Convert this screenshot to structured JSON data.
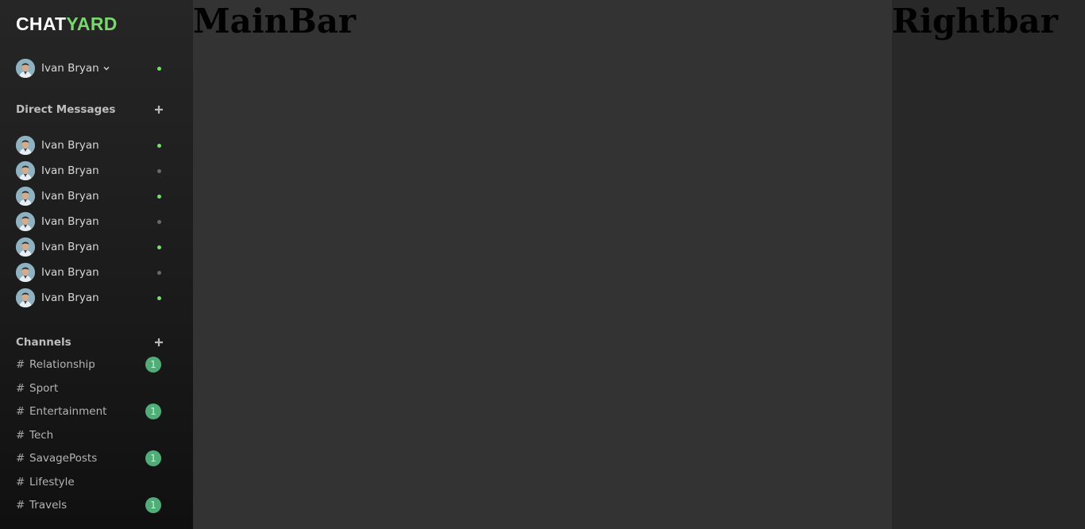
{
  "logo": {
    "part1": "CHAT",
    "part2": "YARD"
  },
  "current_user": {
    "name": "Ivan Bryan",
    "status": "online"
  },
  "direct_messages": {
    "title": "Direct Messages",
    "users": [
      {
        "name": "Ivan Bryan",
        "status": "online"
      },
      {
        "name": "Ivan Bryan",
        "status": "offline"
      },
      {
        "name": "Ivan Bryan",
        "status": "online"
      },
      {
        "name": "Ivan Bryan",
        "status": "offline"
      },
      {
        "name": "Ivan Bryan",
        "status": "online"
      },
      {
        "name": "Ivan Bryan",
        "status": "offline"
      },
      {
        "name": "Ivan Bryan",
        "status": "online"
      }
    ]
  },
  "channels": {
    "title": "Channels",
    "prefix": "#",
    "items": [
      {
        "name": "Relationship",
        "unread": "1"
      },
      {
        "name": "Sport",
        "unread": ""
      },
      {
        "name": "Entertainment",
        "unread": "1"
      },
      {
        "name": "Tech",
        "unread": ""
      },
      {
        "name": "SavagePosts",
        "unread": "1"
      },
      {
        "name": "Lifestyle",
        "unread": ""
      },
      {
        "name": "Travels",
        "unread": "1"
      }
    ]
  },
  "mainbar": {
    "label": "MainBar"
  },
  "rightbar": {
    "label": "Rightbar"
  },
  "colors": {
    "online": "#74e068",
    "offline": "#6a6a6a",
    "accent": "#77d86c",
    "badge": "#4fae78"
  },
  "icons": {
    "add": "plus-icon",
    "dropdown": "chevron-down-icon",
    "avatar": "user-avatar"
  }
}
